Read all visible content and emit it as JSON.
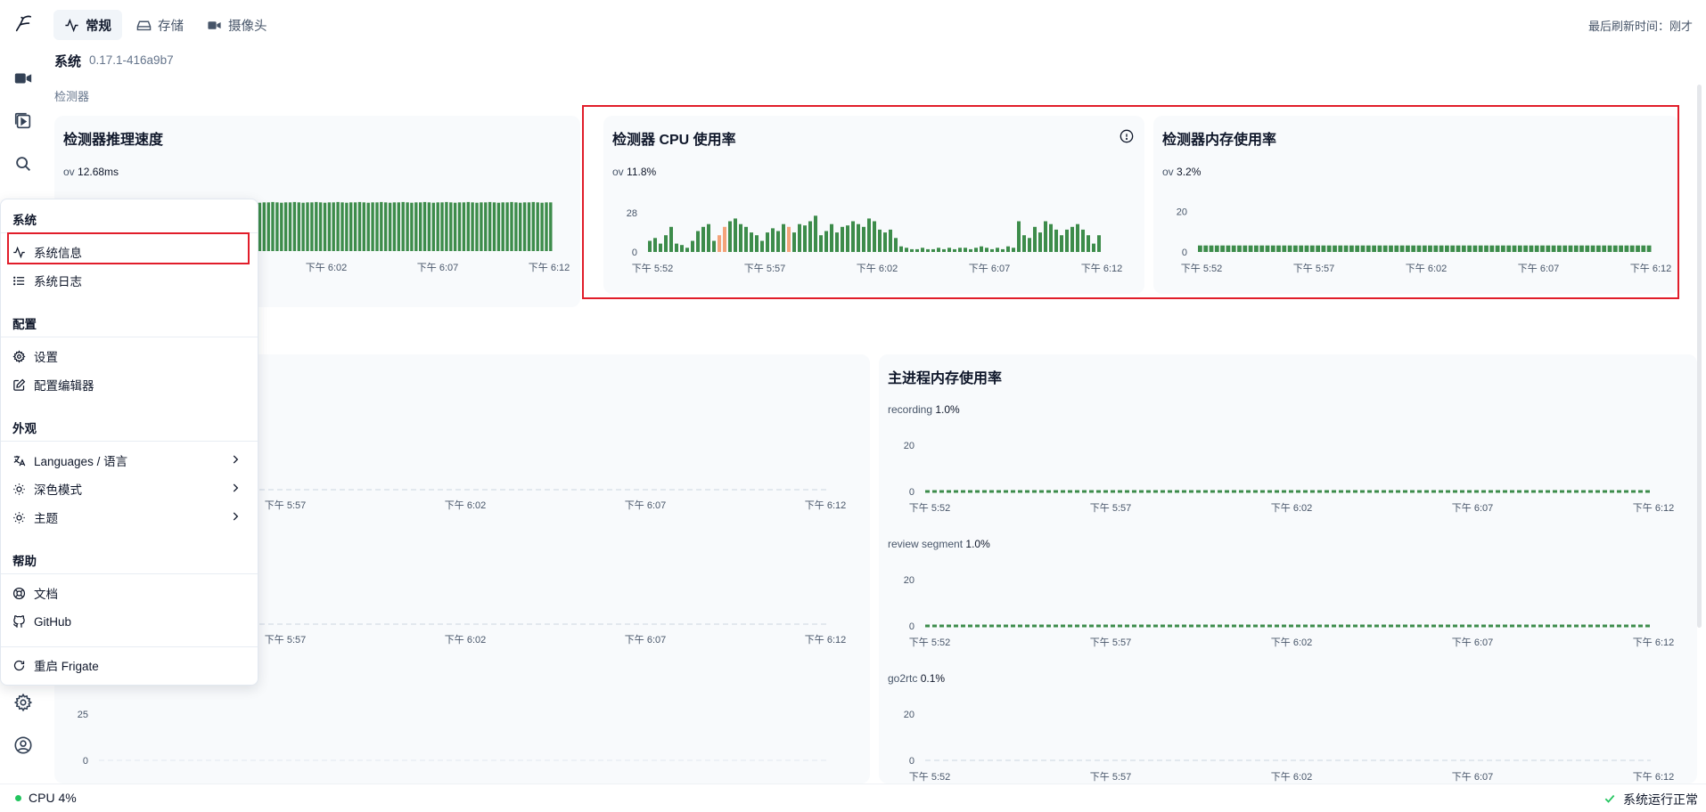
{
  "header": {
    "tabs": [
      {
        "label": "常规",
        "icon": "activity-icon"
      },
      {
        "label": "存储",
        "icon": "hard-drive-icon"
      },
      {
        "label": "摄像头",
        "icon": "video-icon"
      }
    ],
    "last_refresh_label": "最后刷新时间：",
    "last_refresh_value": "刚才"
  },
  "page": {
    "title": "系统",
    "version": "0.17.1-416a9b7",
    "section_detector": "检测器"
  },
  "cards": {
    "inference": {
      "title": "检测器推理速度",
      "series_label": "ov",
      "series_value": "12.68ms"
    },
    "cpu": {
      "title": "检测器 CPU 使用率",
      "series_label": "ov",
      "series_value": "11.8%"
    },
    "memory": {
      "title": "检测器内存使用率",
      "series_label": "ov",
      "series_value": "3.2%"
    },
    "main_memory": {
      "title": "主进程内存使用率"
    }
  },
  "sub_series": [
    {
      "label": "recording",
      "value": "1.0%"
    },
    {
      "label": "review segment",
      "value": "1.0%"
    },
    {
      "label": "go2rtc",
      "value": "0.1%"
    }
  ],
  "x_ticks": [
    "下午 5:52",
    "下午 5:57",
    "下午 6:02",
    "下午 6:07",
    "下午 6:12"
  ],
  "menu": {
    "groups": [
      {
        "heading": "系统",
        "items": [
          {
            "label": "系统信息",
            "icon": "activity-icon"
          },
          {
            "label": "系统日志",
            "icon": "list-icon"
          }
        ]
      },
      {
        "heading": "配置",
        "items": [
          {
            "label": "设置",
            "icon": "gear-icon"
          },
          {
            "label": "配置编辑器",
            "icon": "edit-icon"
          }
        ]
      },
      {
        "heading": "外观",
        "items": [
          {
            "label": "Languages / 语言",
            "icon": "languages-icon"
          },
          {
            "label": "深色模式",
            "icon": "sun-icon"
          },
          {
            "label": "主题",
            "icon": "sun-icon"
          }
        ]
      },
      {
        "heading": "帮助",
        "items": [
          {
            "label": "文档",
            "icon": "lifebuoy-icon"
          },
          {
            "label": "GitHub",
            "icon": "github-icon"
          }
        ]
      }
    ],
    "restart": "重启 Frigate"
  },
  "status": {
    "cpu": "CPU 4%",
    "system_ok": "系统运行正常"
  },
  "colors": {
    "bar_green": "#3d8c4b",
    "bar_orange": "#f4a37a",
    "highlight_red": "#e11d2a",
    "status_green": "#22c55e"
  },
  "chart_data": [
    {
      "type": "bar",
      "title": "检测器推理速度",
      "series": [
        {
          "name": "ov",
          "values": [
            12.7,
            12.6,
            12.7,
            12.8,
            12.7,
            12.6,
            12.7,
            12.7,
            12.8,
            12.7,
            12.6,
            12.7,
            12.7,
            12.8,
            12.7,
            12.6,
            12.7,
            12.7,
            12.8,
            12.7,
            12.6,
            12.7,
            12.7,
            12.8,
            12.7,
            12.6,
            12.7,
            12.7,
            12.8,
            12.7,
            12.6,
            12.7,
            12.7,
            12.8,
            12.7,
            12.6,
            12.7,
            12.7,
            12.8,
            12.7,
            12.6,
            12.7,
            12.7,
            12.8,
            12.7,
            12.6,
            12.7,
            12.7,
            12.8,
            12.7,
            12.6,
            12.7,
            12.7,
            12.8,
            12.7,
            12.6,
            12.7,
            12.7,
            12.8,
            12.7,
            12.6,
            12.7,
            12.7,
            12.8,
            12.7,
            12.6,
            12.7,
            12.7,
            12.8,
            12.7,
            12.6,
            12.7,
            12.7,
            12.8,
            12.7,
            12.6,
            12.7,
            12.7
          ]
        }
      ],
      "x_ticks": [
        "下午 6:02",
        "下午 6:07",
        "下午 6:12"
      ],
      "ylim": [
        0,
        13
      ]
    },
    {
      "type": "bar",
      "title": "检测器 CPU 使用率",
      "series": [
        {
          "name": "ov",
          "values": [
            8,
            10,
            6,
            12,
            18,
            6,
            5,
            3,
            8,
            15,
            18,
            20,
            8,
            12,
            18,
            22,
            24,
            20,
            18,
            14,
            12,
            8,
            14,
            17,
            15,
            20,
            18,
            14,
            20,
            19,
            22,
            26,
            12,
            15,
            20,
            14,
            18,
            19,
            22,
            20,
            18,
            24,
            22,
            16,
            14,
            16,
            10,
            4,
            3,
            2,
            2,
            3,
            2,
            2,
            3,
            2,
            3,
            2,
            3,
            3,
            2,
            3,
            4,
            3,
            2,
            3,
            2,
            4,
            3,
            22,
            12,
            10,
            18,
            14,
            22,
            20,
            16,
            12,
            16,
            18,
            20,
            16,
            12,
            6,
            12
          ]
        }
      ],
      "highlight_indices": [
        13,
        14,
        26
      ],
      "y_ticks": [
        0,
        28
      ],
      "ylim": [
        0,
        30
      ],
      "x_ticks": [
        "下午 5:52",
        "下午 5:57",
        "下午 6:02",
        "下午 6:07",
        "下午 6:12"
      ]
    },
    {
      "type": "bar",
      "title": "检测器内存使用率",
      "series": [
        {
          "name": "ov",
          "values": [
            3.2,
            3.2,
            3.2,
            3.2,
            3.2,
            3.2,
            3.2,
            3.2,
            3.2,
            3.2,
            3.2,
            3.2,
            3.2,
            3.2,
            3.2,
            3.2,
            3.2,
            3.2,
            3.2,
            3.2,
            3.2,
            3.2,
            3.2,
            3.2,
            3.2,
            3.2,
            3.2,
            3.2,
            3.2,
            3.2,
            3.2,
            3.2,
            3.2,
            3.2,
            3.2,
            3.2,
            3.2,
            3.2,
            3.2,
            3.2,
            3.2,
            3.2,
            3.2,
            3.2,
            3.2,
            3.2,
            3.2,
            3.2,
            3.2,
            3.2,
            3.2,
            3.2,
            3.2,
            3.2,
            3.2,
            3.2,
            3.2,
            3.2,
            3.2,
            3.2,
            3.2,
            3.2,
            3.2,
            3.2,
            3.2,
            3.2,
            3.2,
            3.2,
            3.2,
            3.2,
            3.2,
            3.2,
            3.2,
            3.2,
            3.2,
            3.2,
            3.2,
            3.2,
            3.2,
            3.2,
            3.2
          ]
        }
      ],
      "y_ticks": [
        0,
        20
      ],
      "ylim": [
        0,
        25
      ],
      "x_ticks": [
        "下午 5:52",
        "下午 5:57",
        "下午 6:02",
        "下午 6:07",
        "下午 6:12"
      ]
    },
    {
      "type": "bar",
      "title": "主进程内存使用率",
      "series": [
        {
          "name": "recording",
          "values": [
            1.0
          ]
        },
        {
          "name": "review segment",
          "values": [
            1.0
          ]
        },
        {
          "name": "go2rtc",
          "values": [
            0.1
          ]
        }
      ],
      "y_ticks": [
        0,
        20
      ],
      "x_ticks": [
        "下午 5:52",
        "下午 5:57",
        "下午 6:02",
        "下午 6:07",
        "下午 6:12"
      ]
    },
    {
      "type": "bar",
      "title": "",
      "series": [
        {
          "name": "",
          "values": []
        }
      ],
      "y_ticks": [
        0,
        25
      ],
      "x_ticks": [
        "下午 5:57",
        "下午 6:02",
        "下午 6:07",
        "下午 6:12"
      ]
    }
  ]
}
